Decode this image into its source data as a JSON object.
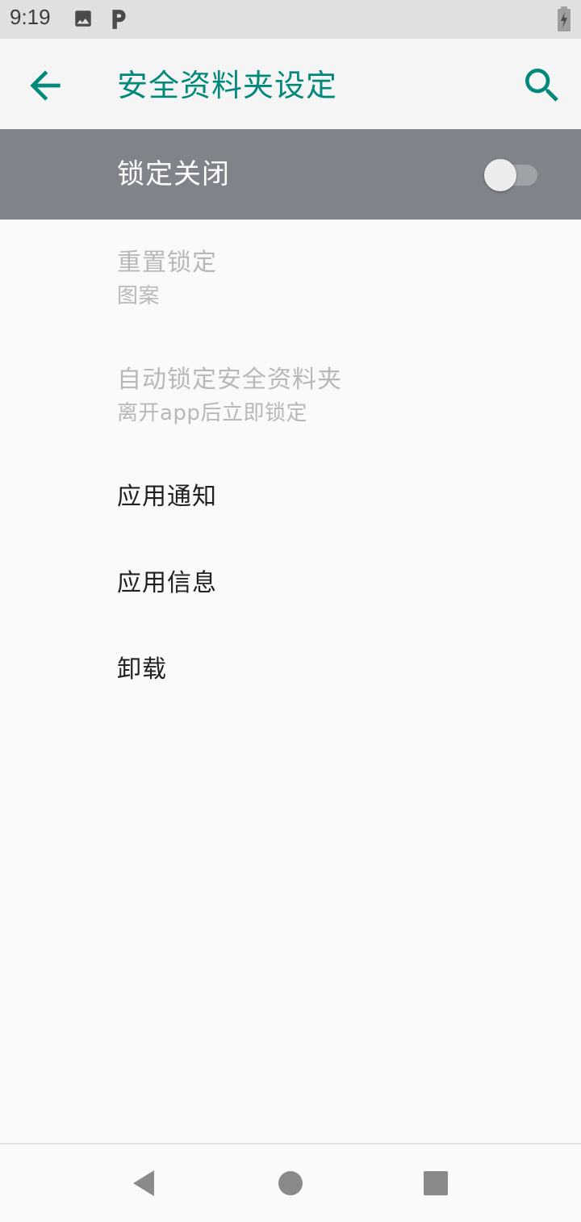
{
  "status_bar": {
    "time": "9:19",
    "icons": [
      "image-icon",
      "parking-icon",
      "battery-charging-icon"
    ]
  },
  "app_bar": {
    "title": "安全资料夹设定",
    "back_icon": "arrow-back-icon",
    "search_icon": "search-icon",
    "accent_color": "#00897b"
  },
  "master_switch": {
    "label": "锁定关闭",
    "checked": false,
    "background": "#80848a"
  },
  "preferences": [
    {
      "title": "重置锁定",
      "summary": "图案",
      "enabled": false
    },
    {
      "title": "自动锁定安全资料夹",
      "summary": "离开app后立即锁定",
      "enabled": false
    },
    {
      "title": "应用通知",
      "enabled": true
    },
    {
      "title": "应用信息",
      "enabled": true
    },
    {
      "title": "卸载",
      "enabled": true
    }
  ],
  "nav_bar": {
    "icons": [
      "back-triangle-icon",
      "home-circle-icon",
      "recents-square-icon"
    ]
  }
}
